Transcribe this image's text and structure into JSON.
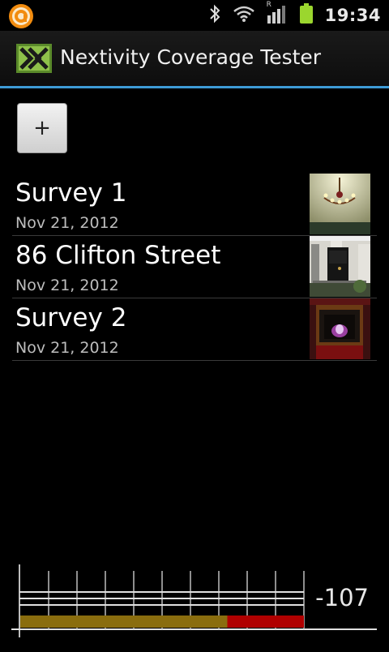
{
  "status_bar": {
    "notification_icon": "app-notification-icon",
    "icons": [
      "bluetooth-icon",
      "wifi-icon",
      "cell-signal-icon",
      "battery-icon"
    ],
    "signal_roaming_label": "R",
    "time": "19:34"
  },
  "header": {
    "logo": "nextivity-logo-icon",
    "title": "Nextivity Coverage Tester",
    "accent_color": "#3d9bd6"
  },
  "toolbar": {
    "add_label": "+"
  },
  "surveys": [
    {
      "title": "Survey 1",
      "date": "Nov 21, 2012",
      "thumbnail": "chandelier-photo"
    },
    {
      "title": "86 Clifton Street",
      "date": "Nov 21, 2012",
      "thumbnail": "front-door-photo"
    },
    {
      "title": "Survey 2",
      "date": "Nov 21, 2012",
      "thumbnail": "fireplace-photo"
    }
  ],
  "signal_meter": {
    "value": "-107",
    "level_fraction": 0.82,
    "weak_fraction": 0.27,
    "colors": {
      "strength": "#8a6d0e",
      "weak": "#b00000",
      "grid": "#bdbdbd"
    }
  }
}
